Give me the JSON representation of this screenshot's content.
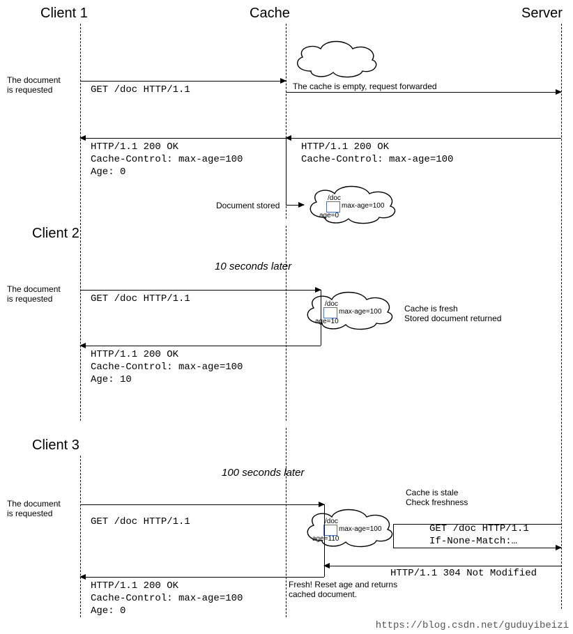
{
  "actors": {
    "client1": "Client 1",
    "client2": "Client 2",
    "client3": "Client 3",
    "cache": "Cache",
    "server": "Server"
  },
  "notes": {
    "docRequested": "The document\nis requested",
    "cacheEmpty": "The cache is empty, request forwarded",
    "docStored": "Document stored",
    "tenSeconds": "10 seconds later",
    "cacheFresh": "Cache is fresh\nStored document returned",
    "hundredSeconds": "100 seconds later",
    "cacheStale": "Cache is stale\nCheck freshness",
    "freshReset": "Fresh! Reset age and returns\ncached document."
  },
  "messages": {
    "getDoc": "GET /doc HTTP/1.1",
    "resp200Age0": "HTTP/1.1 200 OK\nCache-Control: max-age=100\nAge: 0",
    "resp200NoAge": "HTTP/1.1 200 OK\nCache-Control: max-age=100",
    "resp200Age10": "HTTP/1.1 200 OK\nCache-Control: max-age=100\nAge: 10",
    "getDocIfNone": "GET /doc HTTP/1.1\nIf-None-Match:…",
    "resp304": "HTTP/1.1 304 Not Modified"
  },
  "cacheBox": {
    "path": "/doc",
    "maxage": "max-age=100",
    "age0": "age=0",
    "age10": "age=10",
    "age110": "age=110"
  },
  "watermark": "https://blog.csdn.net/guduyibeizi"
}
